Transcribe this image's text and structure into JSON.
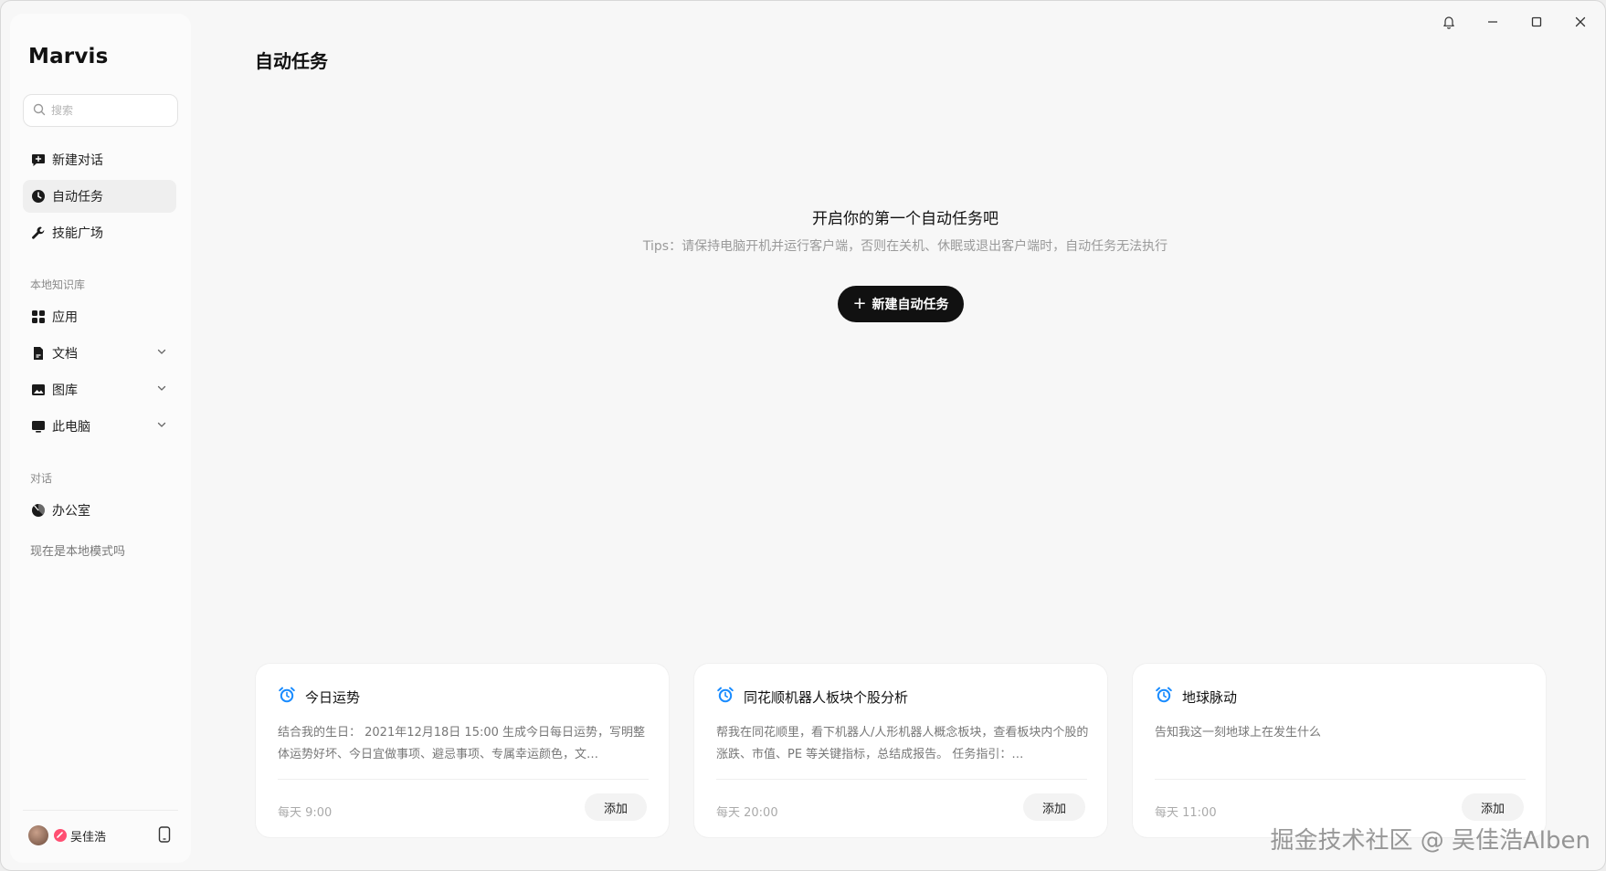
{
  "app": {
    "brand": "Marvis"
  },
  "search": {
    "placeholder": "搜索"
  },
  "nav": [
    {
      "label": "新建对话",
      "icon": "chat-plus-icon"
    },
    {
      "label": "自动任务",
      "icon": "clock-icon"
    },
    {
      "label": "技能广场",
      "icon": "wrench-icon"
    }
  ],
  "knowledge": {
    "section_label": "本地知识库",
    "items": [
      {
        "label": "应用",
        "icon": "apps-grid-icon"
      },
      {
        "label": "文档",
        "icon": "document-icon"
      },
      {
        "label": "图库",
        "icon": "image-icon"
      },
      {
        "label": "此电脑",
        "icon": "monitor-icon"
      }
    ]
  },
  "conversations": {
    "section_label": "对话",
    "items": [
      {
        "label": "办公室",
        "icon": "pie-icon"
      },
      {
        "label": "现在是本地模式吗"
      }
    ]
  },
  "user": {
    "name": "吴佳浩"
  },
  "page": {
    "title": "自动任务",
    "empty_title": "开启你的第一个自动任务吧",
    "empty_tips": "Tips：请保持电脑开机并运行客户端，否则在关机、休眠或退出客户端时，自动任务无法执行",
    "new_task_label": "新建自动任务"
  },
  "cards": [
    {
      "title": "今日运势",
      "description": "结合我的生日： 2021年12月18日 15:00 生成今日每日运势，写明整体运势好坏、今日宜做事项、避忌事项、专属幸运颜色，文…",
      "schedule": "每天 9:00",
      "add_label": "添加"
    },
    {
      "title": "同花顺机器人板块个股分析",
      "description": "帮我在同花顺里，看下机器人/人形机器人概念板块，查看板块内个股的涨跌、市值、PE 等关键指标，总结成报告。 任务指引：…",
      "schedule": "每天 20:00",
      "add_label": "添加"
    },
    {
      "title": "地球脉动",
      "description": "告知我这一刻地球上在发生什么",
      "schedule": "每天 11:00",
      "add_label": "添加"
    }
  ],
  "watermark": "掘金技术社区 @ 吴佳浩Alben",
  "colors": {
    "accent_icon": "#1a8cff",
    "primary_button": "#111111",
    "badge": "#ff4f72"
  }
}
